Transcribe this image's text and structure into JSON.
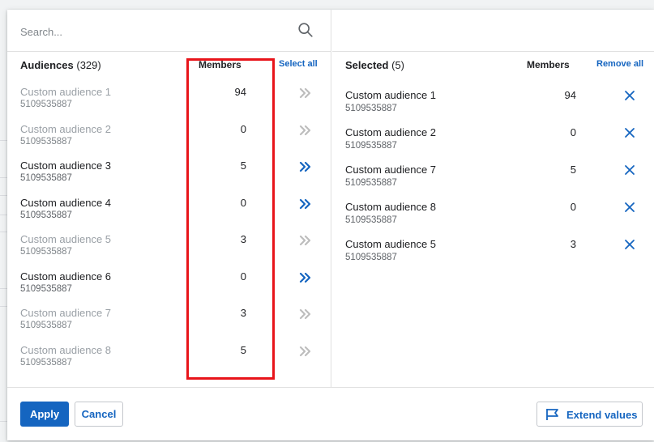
{
  "search": {
    "placeholder": "Search..."
  },
  "audiences": {
    "title": "Audiences",
    "count": "(329)",
    "members_header": "Members",
    "select_all": "Select all",
    "items": [
      {
        "name": "Custom audience 1",
        "id": "5109535887",
        "members": "94",
        "state": "selected"
      },
      {
        "name": "Custom audience 2",
        "id": "5109535887",
        "members": "0",
        "state": "selected"
      },
      {
        "name": "Custom audience 3",
        "id": "5109535887",
        "members": "5",
        "state": "available"
      },
      {
        "name": "Custom audience 4",
        "id": "5109535887",
        "members": "0",
        "state": "available"
      },
      {
        "name": "Custom audience 5",
        "id": "5109535887",
        "members": "3",
        "state": "selected"
      },
      {
        "name": "Custom audience 6",
        "id": "5109535887",
        "members": "0",
        "state": "available"
      },
      {
        "name": "Custom audience 7",
        "id": "5109535887",
        "members": "3",
        "state": "selected"
      },
      {
        "name": "Custom audience 8",
        "id": "5109535887",
        "members": "5",
        "state": "selected"
      }
    ]
  },
  "selected": {
    "title": "Selected",
    "count": "(5)",
    "members_header": "Members",
    "remove_all": "Remove all",
    "items": [
      {
        "name": "Custom audience 1",
        "id": "5109535887",
        "members": "94"
      },
      {
        "name": "Custom audience 2",
        "id": "5109535887",
        "members": "0"
      },
      {
        "name": "Custom audience 7",
        "id": "5109535887",
        "members": "5"
      },
      {
        "name": "Custom audience 8",
        "id": "5109535887",
        "members": "0"
      },
      {
        "name": "Custom audience 5",
        "id": "5109535887",
        "members": "3"
      }
    ]
  },
  "footer": {
    "apply": "Apply",
    "cancel": "Cancel",
    "extend": "Extend values"
  },
  "colors": {
    "accent": "#1565c0",
    "chevron_disabled": "#bdbdbd",
    "highlight": "#e8141a"
  },
  "icons": {
    "search": "search-icon",
    "add": "double-chevron-right-icon",
    "remove": "close-icon",
    "extend": "flag-icon"
  }
}
